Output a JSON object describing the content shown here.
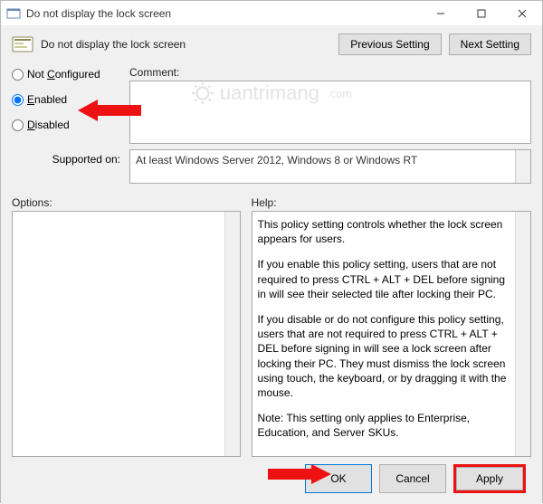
{
  "window": {
    "title": "Do not display the lock screen"
  },
  "header": {
    "title": "Do not display the lock screen",
    "prev_btn": "Previous Setting",
    "next_btn": "Next Setting"
  },
  "radios": {
    "not_configured": "Not Configured",
    "enabled": "Enabled",
    "disabled": "Disabled",
    "selected": "enabled"
  },
  "comment": {
    "label": "Comment:",
    "value": ""
  },
  "supported": {
    "label": "Supported on:",
    "value": "At least Windows Server 2012, Windows 8 or Windows RT"
  },
  "options": {
    "label": "Options:"
  },
  "help": {
    "label": "Help:",
    "paragraphs": [
      "This policy setting controls whether the lock screen appears for users.",
      "If you enable this policy setting, users that are not required to press CTRL + ALT + DEL before signing in will see their selected tile after locking their PC.",
      "If you disable or do not configure this policy setting, users that are not required to press CTRL + ALT + DEL before signing in will see a lock screen after locking their PC. They must dismiss the lock screen using touch, the keyboard, or by dragging it with the mouse.",
      "Note: This setting only applies to Enterprise, Education, and Server SKUs."
    ]
  },
  "footer": {
    "ok": "OK",
    "cancel": "Cancel",
    "apply": "Apply"
  },
  "watermark": "uantrimang"
}
